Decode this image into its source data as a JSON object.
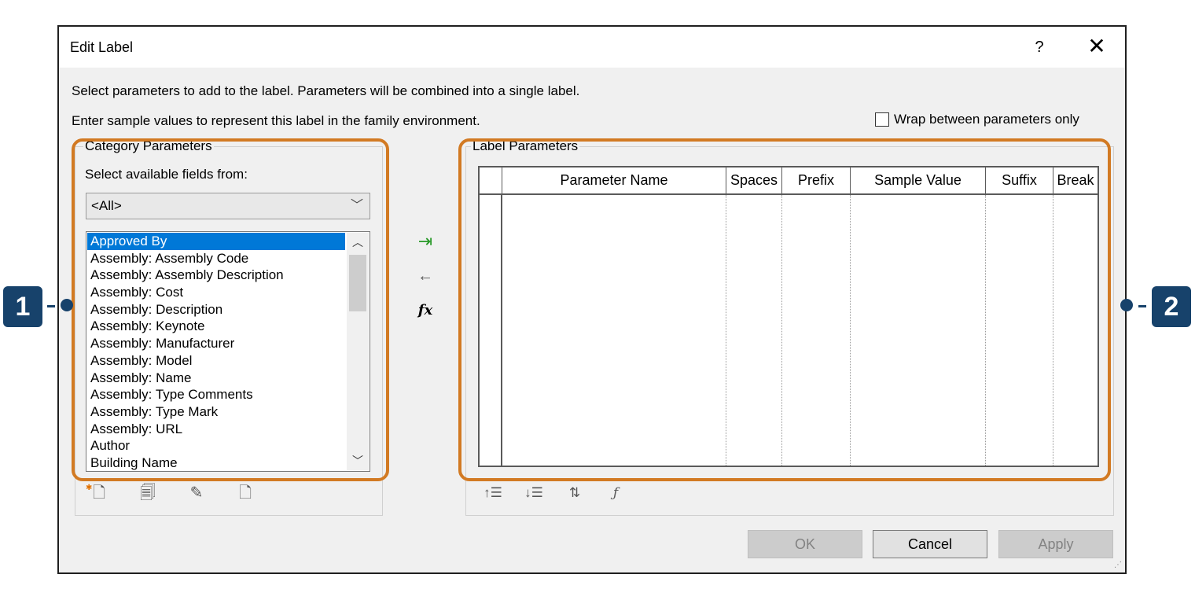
{
  "dialog": {
    "title": "Edit Label",
    "help_label": "?",
    "close_label": "✕",
    "intro_line1": "Select parameters to add to the label.  Parameters will be combined into a single label.",
    "intro_line2": "Enter sample values to represent this label in the family environment.",
    "wrap_option_label": "Wrap between parameters only",
    "wrap_option_checked": false
  },
  "category": {
    "legend": "Category Parameters",
    "select_label": "Select available fields from:",
    "combo_value": "<All>",
    "combo_arrow": "﹀",
    "scroll_up": "︿",
    "scroll_down": "﹀",
    "selected_index": 0,
    "items": [
      "Approved By",
      "Assembly: Assembly Code",
      "Assembly: Assembly Description",
      "Assembly: Cost",
      "Assembly: Description",
      "Assembly: Keynote",
      "Assembly: Manufacturer",
      "Assembly: Model",
      "Assembly: Name",
      "Assembly: Type Comments",
      "Assembly: Type Mark",
      "Assembly: URL",
      "Author",
      "Building Name"
    ],
    "tools": [
      "new-parameter-icon",
      "shared-parameter-icon",
      "edit-parameter-icon",
      "delete-parameter-icon"
    ]
  },
  "move_buttons": {
    "add_icon": "add-to-label-icon",
    "remove_icon": "remove-from-label-icon",
    "remove_glyph": "←",
    "fx_label": "fx"
  },
  "label_parameters": {
    "legend": "Label Parameters",
    "columns": [
      "Parameter Name",
      "Spaces",
      "Prefix",
      "Sample Value",
      "Suffix",
      "Break"
    ],
    "rows": [],
    "tools": [
      "move-up-icon",
      "move-down-icon",
      "sort-icon",
      "formula-icon"
    ]
  },
  "buttons": {
    "ok": "OK",
    "cancel": "Cancel",
    "apply": "Apply",
    "ok_enabled": false,
    "apply_enabled": false
  },
  "callouts": [
    "1",
    "2"
  ],
  "colors": {
    "highlight": "#d27a23",
    "callout": "#17426b",
    "selection": "#0078d7",
    "add_arrow": "#2a9a2a"
  }
}
